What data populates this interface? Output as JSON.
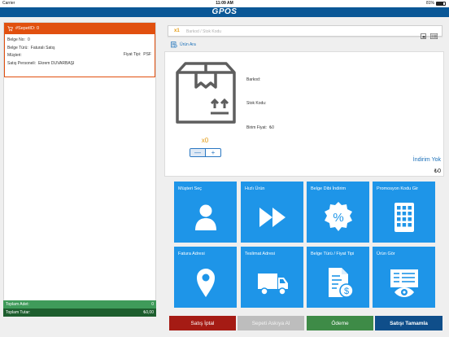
{
  "status": {
    "carrier": "Carrier",
    "time": "11:09 AM",
    "battery": "81%"
  },
  "app": {
    "logo": "GPOS"
  },
  "cart": {
    "header": "#SepetID: 0",
    "belge_no_label": "Belge No:",
    "belge_no": "0",
    "belge_turu_label": "Belge Türü:",
    "belge_turu": "Faturalı Satış",
    "musteri_label": "Müşteri:",
    "musteri": "",
    "personel_label": "Satış Personeli:",
    "personel": "Ekrem DUVARBAŞI",
    "fiyat_tipi_label": "Fiyat Tipi:",
    "fiyat_tipi": "PSF",
    "toplam_adet_label": "Toplam Adet:",
    "toplam_adet": "0",
    "toplam_tutar_label": "Toplam Tutar:",
    "toplam_tutar": "₺0,00"
  },
  "barcode": {
    "multiplier": "x1",
    "placeholder": "Barkod / Stok Kodu"
  },
  "search": {
    "label": "Ürün Ara"
  },
  "product": {
    "quantity": "x0",
    "barkod_label": "Barkod:",
    "barkod": "",
    "stok_label": "Stok Kodu:",
    "stok": "",
    "fiyat_label": "Birim Fiyat:",
    "fiyat": "₺0",
    "discount": "İndirim Yok",
    "price": "₺0",
    "minus": "—",
    "plus": "+"
  },
  "tiles": [
    {
      "label": "Müşteri Seç",
      "icon": "person-icon"
    },
    {
      "label": "Hızlı Ürün",
      "icon": "fast-forward-icon"
    },
    {
      "label": "Belge Dibi İndirim",
      "icon": "percent-badge-icon"
    },
    {
      "label": "Promosyon Kodu Gir",
      "icon": "keypad-icon"
    },
    {
      "label": "Fatura Adresi",
      "icon": "location-pin-icon"
    },
    {
      "label": "Teslimat Adresi",
      "icon": "delivery-truck-icon"
    },
    {
      "label": "Belge Türü / Fiyat Tipi",
      "icon": "document-price-icon"
    },
    {
      "label": "Ürün Gör",
      "icon": "view-document-icon"
    }
  ],
  "buttons": {
    "cancel": "Satış İptal",
    "hold": "Sepeti Askıya Al",
    "pay": "Ödeme",
    "finish": "Satışı Tamamla"
  },
  "colors": {
    "header": "#0a5796",
    "cart_header": "#e1500f",
    "tile": "#1e95e8",
    "cancel": "#a51b14",
    "hold": "#bdbdbd",
    "pay": "#3e8b47",
    "finish": "#0f4e8a",
    "qty": "#e39a11"
  }
}
